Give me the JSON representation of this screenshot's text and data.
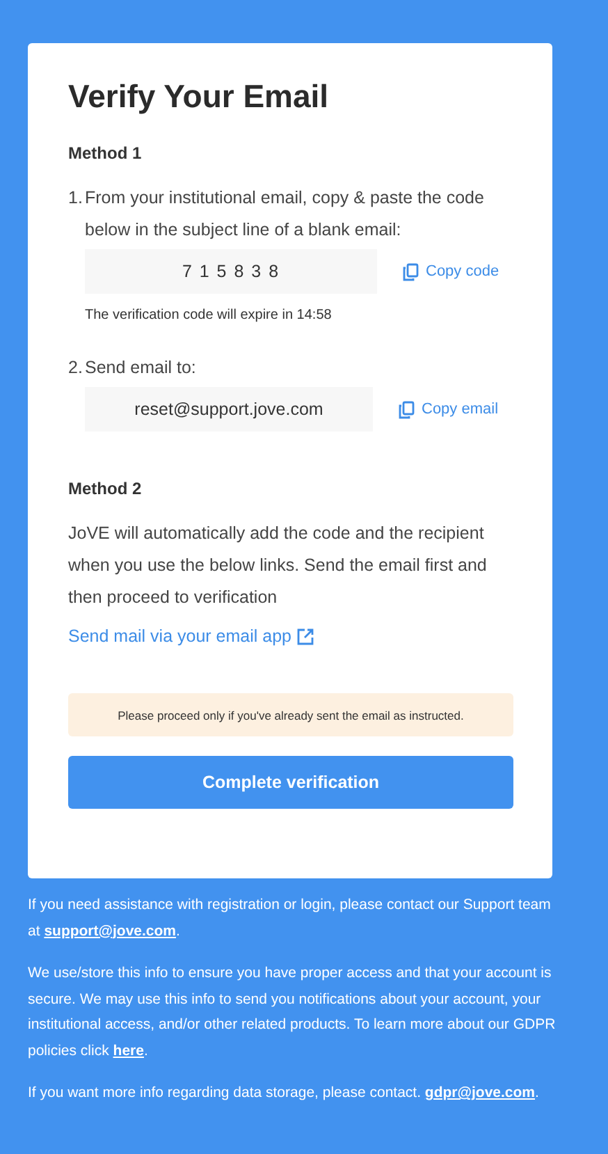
{
  "card": {
    "title": "Verify Your Email",
    "method1": {
      "heading": "Method 1",
      "steps": [
        {
          "number": "1.",
          "text": "From your institutional email, copy & paste the code below in the subject line of a blank email:",
          "value": "7 1 5 8 3 8",
          "kind": "code",
          "copy_label": "Copy code",
          "note": "The verification code will expire in 14:58"
        },
        {
          "number": "2.",
          "text": "Send email to:",
          "value": "reset@support.jove.com",
          "kind": "email",
          "copy_label": "Copy email"
        }
      ]
    },
    "method2": {
      "heading": "Method 2",
      "text": "JoVE will automatically add the code and the recipient when you use the below links. Send the email first and then proceed to verification",
      "link": "Send mail via your email app"
    },
    "notice": "Please proceed only if you've already sent the email as instructed.",
    "button": "Complete verification"
  },
  "footer": [
    {
      "before": "If you need assistance with registration or login, please contact our Support team at ",
      "link": "support@jove.com",
      "after": "."
    },
    {
      "before": "We use/store this info to ensure you have proper access and that your account is secure. We may use this info to send you notifications about your account, your institutional access, and/or other related products. To learn more about our GDPR policies click ",
      "link": "here",
      "after": "."
    },
    {
      "before": "If you want more info regarding data storage, please contact. ",
      "link": "gdpr@jove.com",
      "after": "."
    }
  ]
}
